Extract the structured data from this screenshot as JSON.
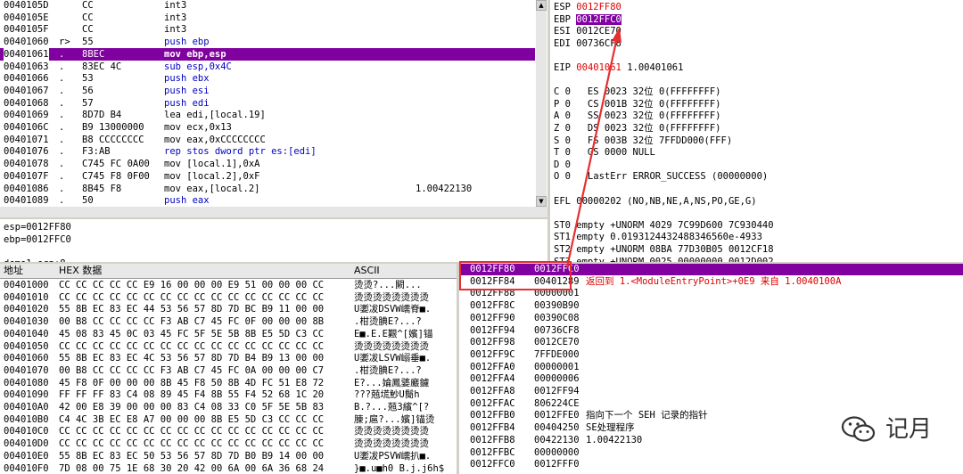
{
  "disasm": {
    "rows": [
      {
        "addr": "0040105D",
        "mark": "",
        "hex": "CC",
        "asm": "int3",
        "tag": "",
        "cls": ""
      },
      {
        "addr": "0040105E",
        "mark": "",
        "hex": "CC",
        "asm": "int3",
        "tag": "",
        "cls": ""
      },
      {
        "addr": "0040105F",
        "mark": "",
        "hex": "CC",
        "asm": "int3",
        "tag": "",
        "cls": ""
      },
      {
        "addr": "00401060",
        "mark": "r>",
        "hex": "55",
        "asm": "push ebp",
        "tag": "",
        "cls": "blue"
      },
      {
        "addr": "00401061",
        "mark": ".",
        "hex": "8BEC",
        "asm": "mov ebp,esp",
        "tag": "",
        "cls": "sel"
      },
      {
        "addr": "00401063",
        "mark": ".",
        "hex": "83EC 4C",
        "asm": "sub esp,0x4C",
        "tag": "",
        "cls": "blue"
      },
      {
        "addr": "00401066",
        "mark": ".",
        "hex": "53",
        "asm": "push ebx",
        "tag": "",
        "cls": "blue"
      },
      {
        "addr": "00401067",
        "mark": ".",
        "hex": "56",
        "asm": "push esi",
        "tag": "",
        "cls": "blue"
      },
      {
        "addr": "00401068",
        "mark": ".",
        "hex": "57",
        "asm": "push edi",
        "tag": "",
        "cls": "blue"
      },
      {
        "addr": "00401069",
        "mark": ".",
        "hex": "8D7D B4",
        "asm": "lea edi,[local.19]",
        "tag": "",
        "cls": ""
      },
      {
        "addr": "0040106C",
        "mark": ".",
        "hex": "B9 13000000",
        "asm": "mov ecx,0x13",
        "tag": "",
        "cls": ""
      },
      {
        "addr": "00401071",
        "mark": ".",
        "hex": "B8 CCCCCCCC",
        "asm": "mov eax,0xCCCCCCCC",
        "tag": "",
        "cls": ""
      },
      {
        "addr": "00401076",
        "mark": ".",
        "hex": "F3:AB",
        "asm": "rep stos dword ptr es:[edi]",
        "tag": "",
        "cls": "blue"
      },
      {
        "addr": "00401078",
        "mark": ".",
        "hex": "C745 FC 0A00",
        "asm": "mov [local.1],0xA",
        "tag": "",
        "cls": ""
      },
      {
        "addr": "0040107F",
        "mark": ".",
        "hex": "C745 F8 0F00",
        "asm": "mov [local.2],0xF",
        "tag": "",
        "cls": ""
      },
      {
        "addr": "00401086",
        "mark": ".",
        "hex": "8B45 F8",
        "asm": "mov eax,[local.2]",
        "tag": "1.00422130",
        "cls": ""
      },
      {
        "addr": "00401089",
        "mark": ".",
        "hex": "50",
        "asm": "push eax",
        "tag": "",
        "cls": "blue"
      },
      {
        "addr": "0040108A",
        "mark": ".",
        "hex": "8B4D FC",
        "asm": "mov ecx,[local.1]",
        "tag": "",
        "cls": ""
      }
    ],
    "info": [
      "esp=0012FF80",
      "ebp=0012FFC0",
      "",
      "demo1.ecp:8"
    ]
  },
  "registers": {
    "rows": [
      {
        "text": "ESP ",
        "val": "0012FF80",
        "valcls": "red",
        "rest": ""
      },
      {
        "text": "EBP ",
        "val": "0012FFC0",
        "valcls": "hl",
        "rest": ""
      },
      {
        "text": "ESI 0012CE70",
        "val": "",
        "valcls": "",
        "rest": ""
      },
      {
        "text": "EDI 00736CF8",
        "val": "",
        "valcls": "",
        "rest": ""
      },
      {
        "text": "",
        "val": "",
        "valcls": "",
        "rest": ""
      },
      {
        "text": "EIP ",
        "val": "00401061",
        "valcls": "red",
        "rest": " 1.00401061"
      },
      {
        "text": "",
        "val": "",
        "valcls": "",
        "rest": ""
      },
      {
        "text": "C 0   ES 0023 32位 0(FFFFFFFF)",
        "val": "",
        "valcls": "",
        "rest": ""
      },
      {
        "text": "P 0   CS 001B 32位 0(FFFFFFFF)",
        "val": "",
        "valcls": "",
        "rest": ""
      },
      {
        "text": "A 0   SS 0023 32位 0(FFFFFFFF)",
        "val": "",
        "valcls": "",
        "rest": ""
      },
      {
        "text": "Z 0   DS 0023 32位 0(FFFFFFFF)",
        "val": "",
        "valcls": "",
        "rest": ""
      },
      {
        "text": "S 0   FS 003B 32位 7FFDD000(FFF)",
        "val": "",
        "valcls": "",
        "rest": ""
      },
      {
        "text": "T 0   GS 0000 NULL",
        "val": "",
        "valcls": "",
        "rest": ""
      },
      {
        "text": "D 0",
        "val": "",
        "valcls": "",
        "rest": ""
      },
      {
        "text": "O 0   LastErr ERROR_SUCCESS (00000000)",
        "val": "",
        "valcls": "",
        "rest": ""
      },
      {
        "text": "",
        "val": "",
        "valcls": "",
        "rest": ""
      },
      {
        "text": "EFL 00000202 (NO,NB,NE,A,NS,PO,GE,G)",
        "val": "",
        "valcls": "",
        "rest": ""
      },
      {
        "text": "",
        "val": "",
        "valcls": "",
        "rest": ""
      },
      {
        "text": "ST0 empty +UNORM 4029 7C99D600 7C930440",
        "val": "",
        "valcls": "",
        "rest": ""
      },
      {
        "text": "ST1 empty 0.0193124432488346560e-4933",
        "val": "",
        "valcls": "",
        "rest": ""
      },
      {
        "text": "ST2 empty +UNORM 08BA 77D30B05 0012CF18",
        "val": "",
        "valcls": "",
        "rest": ""
      },
      {
        "text": "ST3 empty +UNORM 0025 00000000 0012D002",
        "val": "",
        "valcls": "",
        "rest": ""
      },
      {
        "text": "ST4 empty -UNORM D2B0 000382E8 004C004A",
        "val": "",
        "valcls": "",
        "rest": ""
      }
    ]
  },
  "dump": {
    "header": {
      "addr": "地址",
      "hex": "HEX 数据",
      "ascii": "ASCII"
    },
    "rows": [
      {
        "addr": "00401000",
        "hex": "CC CC CC CC CC E9 16 00 00 00 E9 51 00 00 00 CC",
        "ascii": "烫烫?...闝..."
      },
      {
        "addr": "00401010",
        "hex": "CC CC CC CC CC CC CC CC CC CC CC CC CC CC CC CC",
        "ascii": "烫烫烫烫烫烫烫烫"
      },
      {
        "addr": "00401020",
        "hex": "55 8B EC 83 EC 44 53 56 57 8D 7D BC B9 11 00 00",
        "ascii": "U嬱冹DSVW嶿脊■."
      },
      {
        "addr": "00401030",
        "hex": "00 B8 CC CC CC CC F3 AB C7 45 FC 0F 00 00 00 8B",
        "ascii": ".柑烫腆E?...?"
      },
      {
        "addr": "00401040",
        "hex": "45 08 83 45 0C 03 45 FC 5F 5E 5B 8B E5 5D C3 CC",
        "ascii": "E■.E.E艱^[嬪]锚"
      },
      {
        "addr": "00401050",
        "hex": "CC CC CC CC CC CC CC CC CC CC CC CC CC CC CC CC",
        "ascii": "烫烫烫烫烫烫烫烫"
      },
      {
        "addr": "00401060",
        "hex": "55 8B EC 83 EC 4C 53 56 57 8D 7D B4 B9 13 00 00",
        "ascii": "U嬱冹LSVW嵶垂■."
      },
      {
        "addr": "00401070",
        "hex": "00 B8 CC CC CC CC F3 AB C7 45 FC 0A 00 00 00 C7",
        "ascii": ".柑烫腆E?...?"
      },
      {
        "addr": "00401080",
        "hex": "45 F8 0F 00 00 00 8B 45 F8 50 8B 4D FC 51 E8 72",
        "ascii": "E?...婨鳳婱黀鑢"
      },
      {
        "addr": "00401090",
        "hex": "FF FF FF 83 C4 08 89 45 F4 8B 55 F4 52 68 1C 20",
        "ascii": "???兡塃魦U鬜h "
      },
      {
        "addr": "004010A0",
        "hex": "42 00 E8 39 00 00 00 83 C4 08 33 C0 5F 5E 5B 83",
        "ascii": "B.?...兡3繽^[?"
      },
      {
        "addr": "004010B0",
        "hex": "C4 4C 3B EC E8 A7 00 00 00 8B E5 5D C3 CC CC CC",
        "ascii": "腖;扈?...嬪]锚烫"
      },
      {
        "addr": "004010C0",
        "hex": "CC CC CC CC CC CC CC CC CC CC CC CC CC CC CC CC",
        "ascii": "烫烫烫烫烫烫烫烫"
      },
      {
        "addr": "004010D0",
        "hex": "CC CC CC CC CC CC CC CC CC CC CC CC CC CC CC CC",
        "ascii": "烫烫烫烫烫烫烫烫"
      },
      {
        "addr": "004010E0",
        "hex": "55 8B EC 83 EC 50 53 56 57 8D 7D B0 B9 14 00 00",
        "ascii": "U嬱冹PSVW嶿扒■."
      },
      {
        "addr": "004010F0",
        "hex": "7D 08 00 75 1E 68 30 20 42 00 6A 00 6A 36 68 24",
        "ascii": "}■.u■h0 B.j.j6h$"
      }
    ]
  },
  "stack": {
    "rows": [
      {
        "addr": "0012FF80",
        "val": "0012FFC0",
        "cmt": "",
        "cmtcls": "",
        "cls": "top"
      },
      {
        "addr": "0012FF84",
        "val": "00401289",
        "cmt": "返回到 1.<ModuleEntryPoint>+0E9 来自 1.0040100A",
        "cmtcls": "red",
        "cls": ""
      },
      {
        "addr": "0012FF88",
        "val": "00000001",
        "cmt": "",
        "cmtcls": "",
        "cls": ""
      },
      {
        "addr": "0012FF8C",
        "val": "00390B90",
        "cmt": "",
        "cmtcls": "",
        "cls": ""
      },
      {
        "addr": "0012FF90",
        "val": "00390C08",
        "cmt": "",
        "cmtcls": "",
        "cls": ""
      },
      {
        "addr": "0012FF94",
        "val": "00736CF8",
        "cmt": "",
        "cmtcls": "",
        "cls": ""
      },
      {
        "addr": "0012FF98",
        "val": "0012CE70",
        "cmt": "",
        "cmtcls": "",
        "cls": ""
      },
      {
        "addr": "0012FF9C",
        "val": "7FFDE000",
        "cmt": "",
        "cmtcls": "",
        "cls": ""
      },
      {
        "addr": "0012FFA0",
        "val": "00000001",
        "cmt": "",
        "cmtcls": "",
        "cls": ""
      },
      {
        "addr": "0012FFA4",
        "val": "00000006",
        "cmt": "",
        "cmtcls": "",
        "cls": ""
      },
      {
        "addr": "0012FFA8",
        "val": "0012FF94",
        "cmt": "",
        "cmtcls": "",
        "cls": ""
      },
      {
        "addr": "0012FFAC",
        "val": "806224CE",
        "cmt": "",
        "cmtcls": "",
        "cls": ""
      },
      {
        "addr": "0012FFB0",
        "val": "0012FFE0",
        "cmt": "指向下一个 SEH 记录的指针",
        "cmtcls": "",
        "cls": ""
      },
      {
        "addr": "0012FFB4",
        "val": "00404250",
        "cmt": "SE处理程序",
        "cmtcls": "",
        "cls": ""
      },
      {
        "addr": "0012FFB8",
        "val": "00422130",
        "cmt": "1.00422130",
        "cmtcls": "",
        "cls": ""
      },
      {
        "addr": "0012FFBC",
        "val": "00000000",
        "cmt": "",
        "cmtcls": "",
        "cls": ""
      },
      {
        "addr": "0012FFC0",
        "val": "0012FFF0",
        "cmt": "",
        "cmtcls": "",
        "cls": ""
      }
    ]
  },
  "watermark": {
    "text": "记月",
    "icon": "wechat-icon"
  },
  "colors": {
    "select": "#8000a0",
    "red": "#e00000",
    "blue": "#0000c0",
    "annot": "#e53030"
  }
}
